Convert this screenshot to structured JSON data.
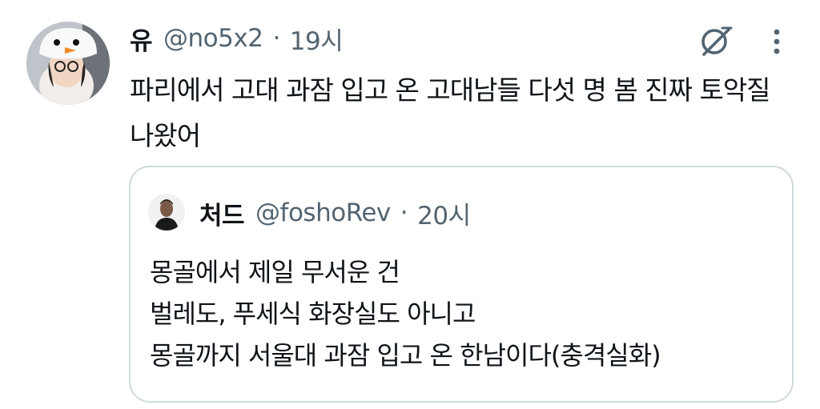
{
  "tweet": {
    "author_name": "유",
    "handle": "@no5x2",
    "separator": "·",
    "time": "19시",
    "text": "파리에서 고대 과잠 입고 온 고대남들 다섯 명 봄 진짜 토악질\n나왔어"
  },
  "quote": {
    "author_name": "처드",
    "handle": "@foshoRev",
    "separator": "·",
    "time": "20시",
    "lines": [
      "몽골에서 제일 무서운 건",
      "벌레도, 푸세식 화장실도 아니고",
      "몽골까지 서울대 과잠 입고 온 한남이다(충격실화)"
    ]
  },
  "icons": {
    "grok": "grok-icon",
    "more": "more-options-icon"
  },
  "colors": {
    "text": "#0f1419",
    "secondary": "#536471",
    "border": "#cfd9de"
  }
}
